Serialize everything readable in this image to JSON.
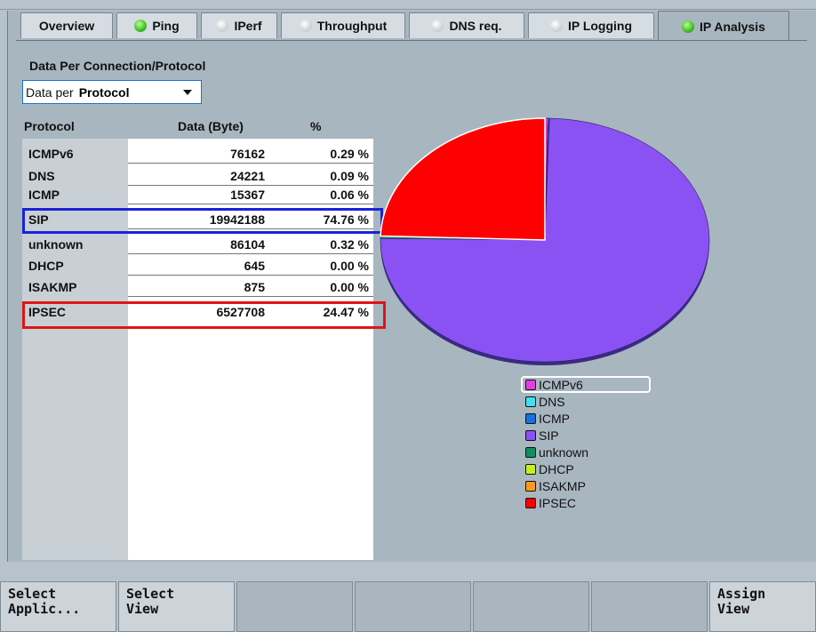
{
  "tabs": [
    {
      "label": "Overview",
      "led": "none",
      "active": false
    },
    {
      "label": "Ping",
      "led": "green",
      "active": false
    },
    {
      "label": "IPerf",
      "led": "grey",
      "active": false
    },
    {
      "label": "Throughput",
      "led": "grey",
      "active": false
    },
    {
      "label": "DNS req.",
      "led": "grey",
      "active": false
    },
    {
      "label": "IP Logging",
      "led": "grey",
      "active": false
    },
    {
      "label": "IP Analysis",
      "led": "green",
      "active": true
    }
  ],
  "panel": {
    "title": "Data Per Connection/Protocol",
    "selector_label": "Data per",
    "selector_value": "Protocol"
  },
  "table": {
    "headers": [
      "Protocol",
      "Data (Byte)",
      "%"
    ],
    "rows": [
      {
        "protocol": "ICMPv6",
        "bytes": "76162",
        "pct": "0.29 %"
      },
      {
        "protocol": "DNS",
        "bytes": "24221",
        "pct": "0.09 %"
      },
      {
        "protocol": "ICMP",
        "bytes": "15367",
        "pct": "0.06 %"
      },
      {
        "protocol": "SIP",
        "bytes": "19942188",
        "pct": "74.76 %"
      },
      {
        "protocol": "unknown",
        "bytes": "86104",
        "pct": "0.32 %"
      },
      {
        "protocol": "DHCP",
        "bytes": "645",
        "pct": "0.00 %"
      },
      {
        "protocol": "ISAKMP",
        "bytes": "875",
        "pct": "0.00 %"
      },
      {
        "protocol": "IPSEC",
        "bytes": "6527708",
        "pct": "24.47 %"
      }
    ]
  },
  "chart_data": {
    "type": "pie",
    "labels": [
      "ICMPv6",
      "DNS",
      "ICMP",
      "SIP",
      "unknown",
      "DHCP",
      "ISAKMP",
      "IPSEC"
    ],
    "values": [
      0.29,
      0.09,
      0.06,
      74.76,
      0.32,
      0.0,
      0.0,
      24.47
    ],
    "colors": [
      "#e040e0",
      "#40e0f0",
      "#1870e0",
      "#8a52f2",
      "#0f8f5f",
      "#c8f020",
      "#ff9a20",
      "#ff0000"
    ],
    "legend": "bottom"
  },
  "softkeys": [
    {
      "line1": "Select",
      "line2": "Applic..."
    },
    {
      "line1": "Select",
      "line2": "View"
    },
    {
      "line1": "",
      "line2": ""
    },
    {
      "line1": "",
      "line2": ""
    },
    {
      "line1": "",
      "line2": ""
    },
    {
      "line1": "",
      "line2": ""
    },
    {
      "line1": "Assign",
      "line2": "View"
    }
  ]
}
